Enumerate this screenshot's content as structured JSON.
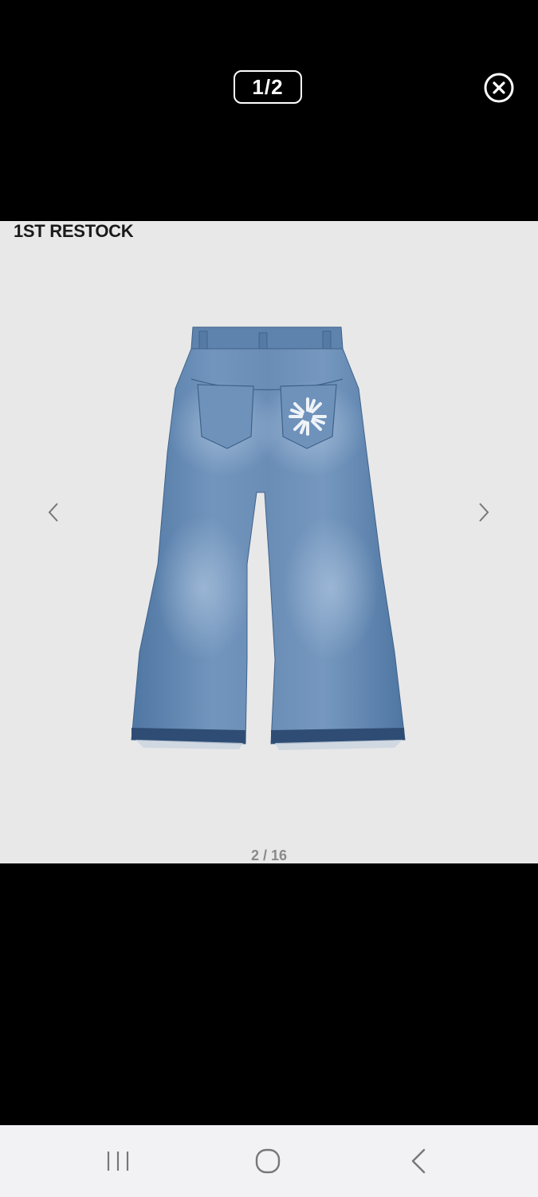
{
  "viewer": {
    "page_counter": "1/2",
    "close_icon": "close-circle-icon"
  },
  "product": {
    "badge": "1ST RESTOCK",
    "image": "wide-leg-denim-jeans-back-view",
    "slide_counter": "2 / 16",
    "prev_icon": "chevron-left-icon",
    "next_icon": "chevron-right-icon"
  },
  "system_nav": {
    "recents_icon": "recents-icon",
    "home_icon": "home-icon",
    "back_icon": "back-icon"
  },
  "colors": {
    "background": "#000000",
    "panel": "#e8e8e9",
    "denim": "#5b83ae",
    "nav_bar": "#f2f2f4"
  }
}
